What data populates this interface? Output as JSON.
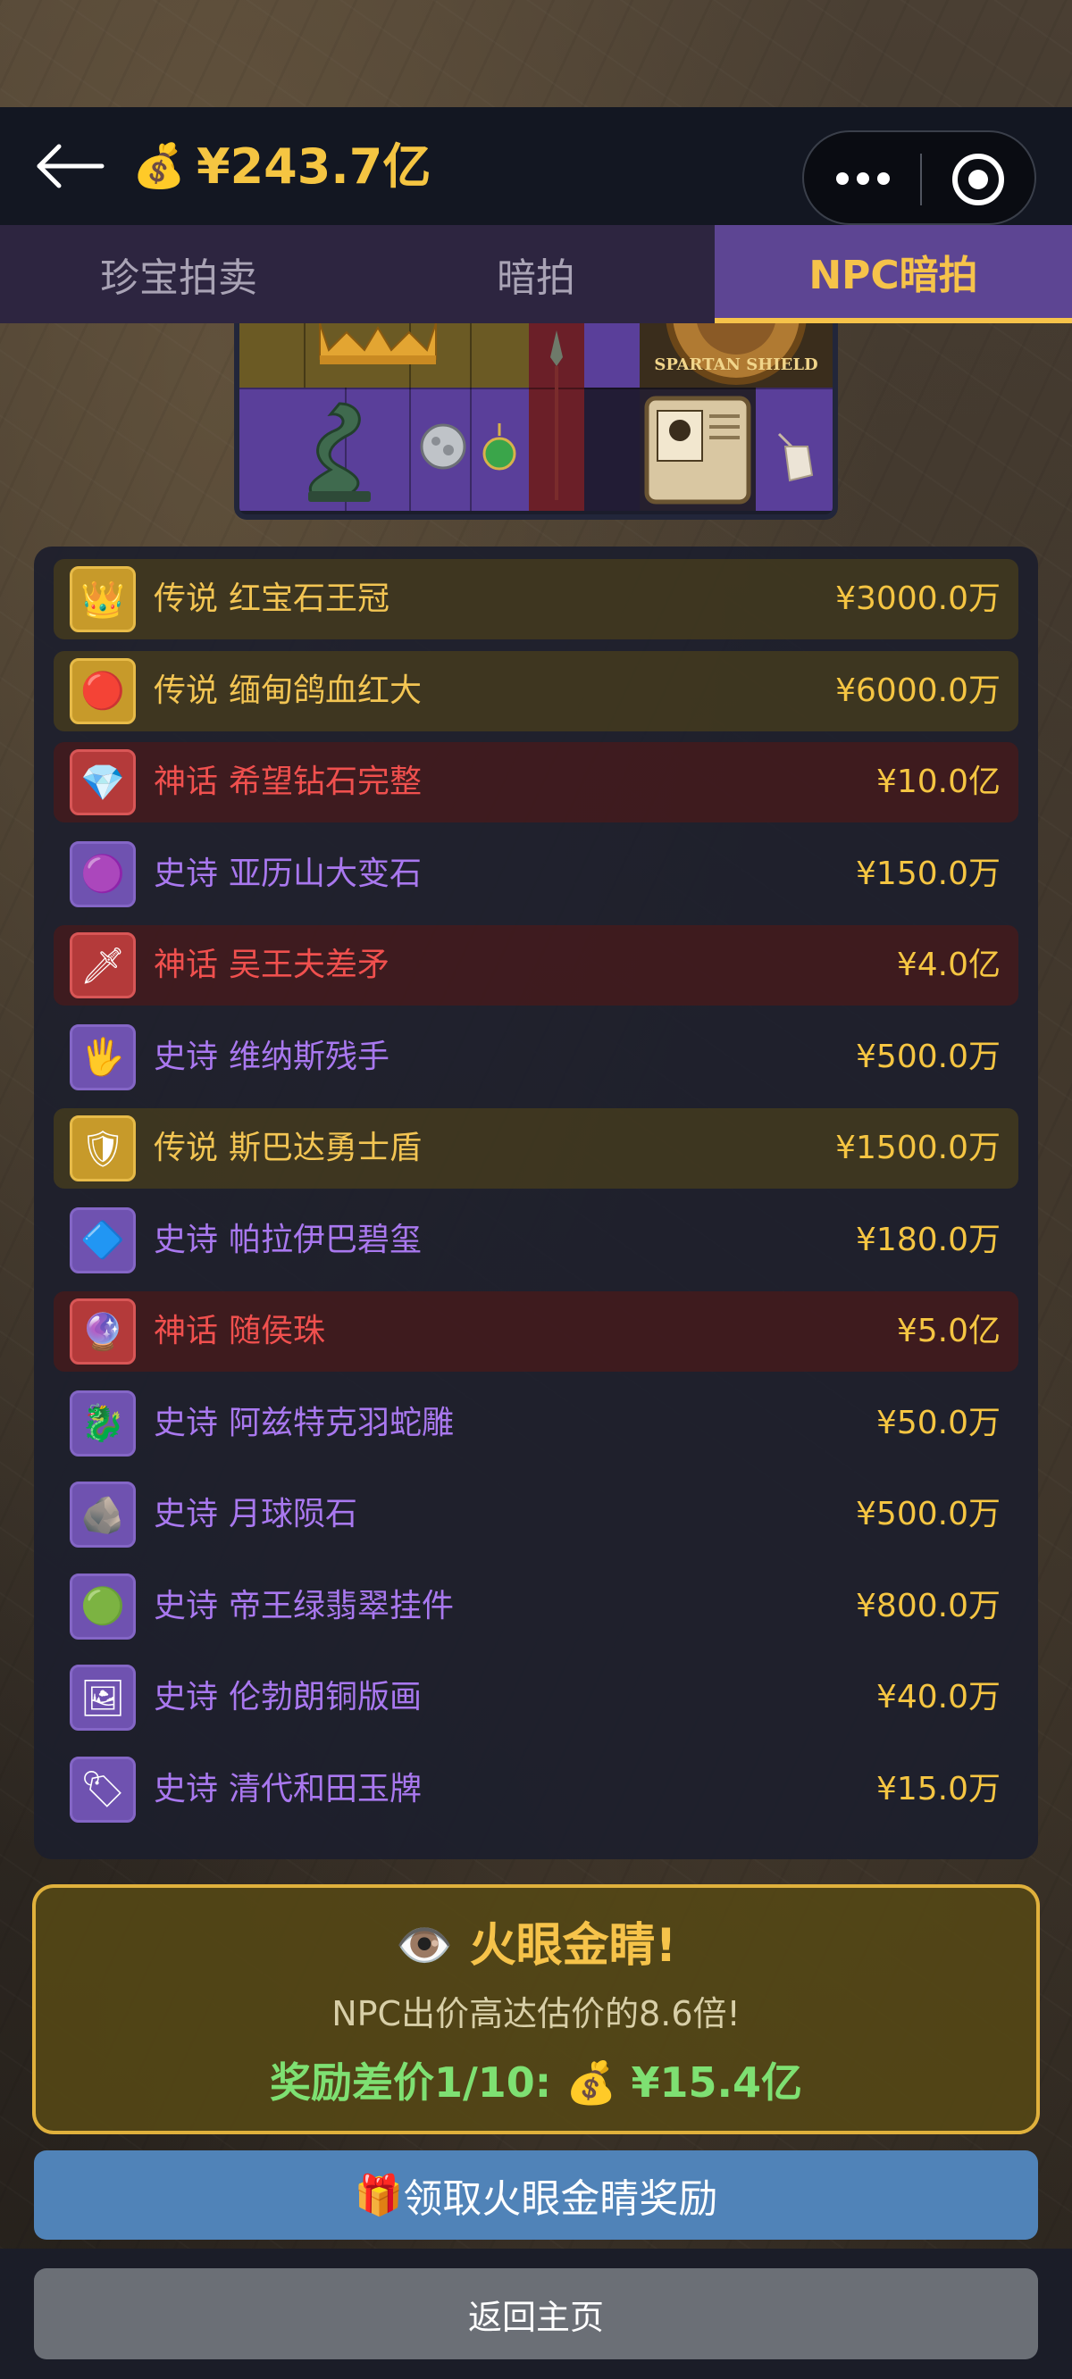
{
  "header": {
    "balance_icon": "money-bag-icon",
    "balance": "¥243.7亿"
  },
  "tabs": [
    {
      "label": "珍宝拍卖",
      "active": false
    },
    {
      "label": "暗拍",
      "active": false
    },
    {
      "label": "NPC暗拍",
      "active": true
    }
  ],
  "items": [
    {
      "rarity": "传说",
      "name": "红宝石王冠",
      "price": "¥3000.0万",
      "tier": "legendary",
      "icon": "crown-icon"
    },
    {
      "rarity": "传说",
      "name": "缅甸鸽血红大",
      "price": "¥6000.0万",
      "tier": "legendary",
      "icon": "ruby-icon"
    },
    {
      "rarity": "神话",
      "name": "希望钻石完整",
      "price": "¥10.0亿",
      "tier": "mythic",
      "icon": "diamond-icon"
    },
    {
      "rarity": "史诗",
      "name": "亚历山大变石",
      "price": "¥150.0万",
      "tier": "epic",
      "icon": "gem-icon"
    },
    {
      "rarity": "神话",
      "name": "吴王夫差矛",
      "price": "¥4.0亿",
      "tier": "mythic",
      "icon": "spear-icon"
    },
    {
      "rarity": "史诗",
      "name": "维纳斯残手",
      "price": "¥500.0万",
      "tier": "epic",
      "icon": "statue-hand-icon"
    },
    {
      "rarity": "传说",
      "name": "斯巴达勇士盾",
      "price": "¥1500.0万",
      "tier": "legendary",
      "icon": "shield-icon"
    },
    {
      "rarity": "史诗",
      "name": "帕拉伊巴碧玺",
      "price": "¥180.0万",
      "tier": "epic",
      "icon": "tourmaline-icon"
    },
    {
      "rarity": "神话",
      "name": "随侯珠",
      "price": "¥5.0亿",
      "tier": "mythic",
      "icon": "pearl-icon"
    },
    {
      "rarity": "史诗",
      "name": "阿兹特克羽蛇雕",
      "price": "¥50.0万",
      "tier": "epic",
      "icon": "serpent-statue-icon"
    },
    {
      "rarity": "史诗",
      "name": "月球陨石",
      "price": "¥500.0万",
      "tier": "epic",
      "icon": "meteorite-icon"
    },
    {
      "rarity": "史诗",
      "name": "帝王绿翡翠挂件",
      "price": "¥800.0万",
      "tier": "epic",
      "icon": "jade-pendant-icon"
    },
    {
      "rarity": "史诗",
      "name": "伦勃朗铜版画",
      "price": "¥40.0万",
      "tier": "epic",
      "icon": "etching-icon"
    },
    {
      "rarity": "史诗",
      "name": "清代和田玉牌",
      "price": "¥15.0万",
      "tier": "epic",
      "icon": "jade-tablet-icon"
    }
  ],
  "reward": {
    "title_icon": "eye-icon",
    "title": "火眼金睛!",
    "subtitle": "NPC出价高达估价的8.6倍!",
    "amount_label": "奖励差价1/10:",
    "amount_icon": "money-bag-icon",
    "amount": "¥15.4亿"
  },
  "buttons": {
    "claim_icon": "gift-icon",
    "claim": "领取火眼金睛奖励",
    "home": "返回主页"
  },
  "grid": {
    "shield_text": "SPARTAN SHIELD"
  }
}
